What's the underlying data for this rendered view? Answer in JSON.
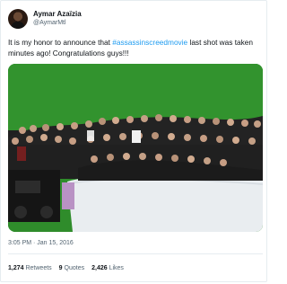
{
  "user": {
    "display_name": "Aymar Azaïzia",
    "handle": "@AymarMtl"
  },
  "tweet": {
    "text_before": "It is my honor to announce that ",
    "hashtag": "#assassinscreedmovie",
    "text_after": " last shot was taken minutes ago! Congratulations guys!!!"
  },
  "photo": {
    "subject": "group photo on green screen set",
    "colors": {
      "green_screen": "#2f8c2b",
      "floor": "#e9edf0",
      "crowd_dark": "#1f1f1f"
    }
  },
  "meta": {
    "timestamp": "3:05 PM · Jan 15, 2016"
  },
  "stats": {
    "retweets_value": "1,274",
    "retweets_label": "Retweets",
    "quotes_value": "9",
    "quotes_label": "Quotes",
    "likes_value": "2,426",
    "likes_label": "Likes"
  }
}
